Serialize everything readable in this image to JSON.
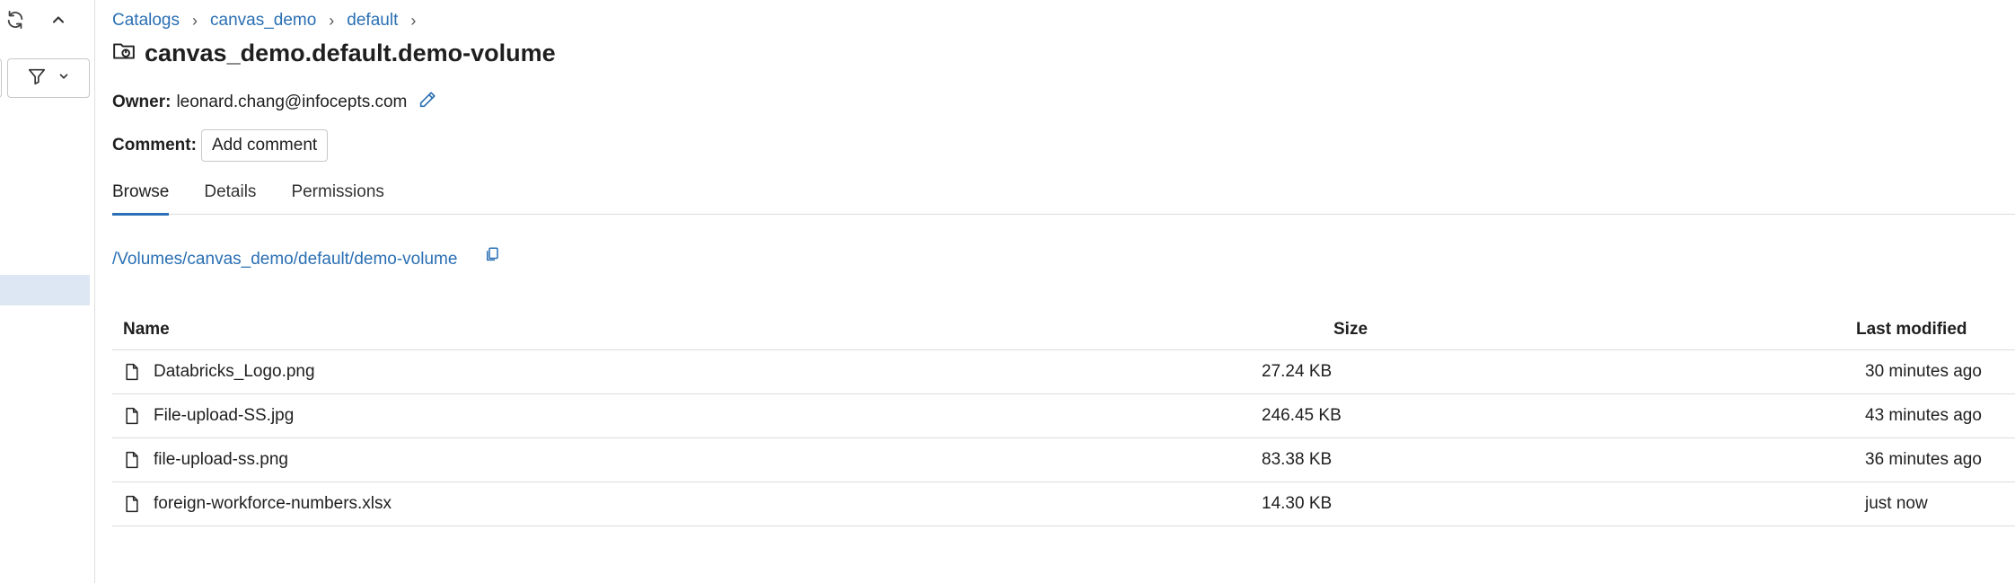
{
  "breadcrumb": {
    "items": [
      "Catalogs",
      "canvas_demo",
      "default"
    ],
    "separator": "›"
  },
  "title": "canvas_demo.default.demo-volume",
  "owner": {
    "label": "Owner:",
    "value": "leonard.chang@infocepts.com"
  },
  "comment": {
    "label": "Comment:",
    "button": "Add comment"
  },
  "tabs": [
    {
      "label": "Browse",
      "active": true
    },
    {
      "label": "Details",
      "active": false
    },
    {
      "label": "Permissions",
      "active": false
    }
  ],
  "path": "/Volumes/canvas_demo/default/demo-volume",
  "table": {
    "headers": {
      "name": "Name",
      "size": "Size",
      "modified": "Last modified"
    },
    "rows": [
      {
        "name": "Databricks_Logo.png",
        "size": "27.24 KB",
        "modified": "30 minutes ago"
      },
      {
        "name": "File-upload-SS.jpg",
        "size": "246.45 KB",
        "modified": "43 minutes ago"
      },
      {
        "name": "file-upload-ss.png",
        "size": "83.38 KB",
        "modified": "36 minutes ago"
      },
      {
        "name": "foreign-workforce-numbers.xlsx",
        "size": "14.30 KB",
        "modified": "just now"
      }
    ]
  },
  "colors": {
    "link": "#2a6fb3",
    "selected_bg": "#dde7f3",
    "border": "#dcdcdc"
  },
  "icons": [
    "refresh-icon",
    "chevron-up-icon",
    "filter-icon",
    "chevron-down-icon",
    "volume-icon",
    "pencil-icon",
    "copy-icon",
    "file-icon"
  ]
}
